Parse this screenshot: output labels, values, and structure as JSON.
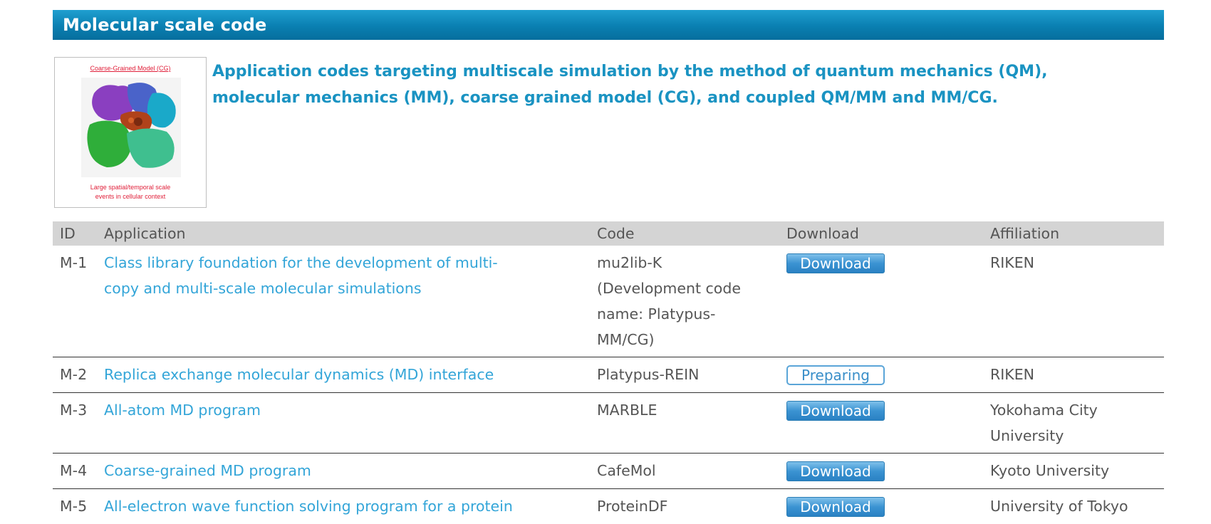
{
  "section": {
    "title": "Molecular scale code"
  },
  "thumbnail": {
    "title": "Coarse-Grained Model (CG)",
    "caption_lines": [
      "Large spatial/temporal scale",
      "events in cellular context"
    ]
  },
  "intro": {
    "lines": [
      "Application codes targeting multiscale simulation by the method of quantum mechanics (QM),",
      "molecular mechanics (MM), coarse grained model (CG), and coupled QM/MM and MM/CG."
    ]
  },
  "table": {
    "headers": {
      "id": "ID",
      "application": "Application",
      "code": "Code",
      "download": "Download",
      "affiliation": "Affiliation"
    },
    "rows": [
      {
        "id": "M-1",
        "application_lines": [
          "Class library foundation for the development of multi-",
          "copy and multi-scale molecular simulations"
        ],
        "code_lines": [
          "mu2lib-K",
          "(Development code",
          "name: Platypus-",
          "MM/CG)"
        ],
        "button": "Download",
        "affiliation_lines": [
          "RIKEN"
        ]
      },
      {
        "id": "M-2",
        "application_lines": [
          "Replica exchange molecular dynamics (MD) interface"
        ],
        "code_lines": [
          "Platypus-REIN"
        ],
        "button": "Preparing",
        "affiliation_lines": [
          "RIKEN"
        ]
      },
      {
        "id": "M-3",
        "application_lines": [
          "All-atom MD program"
        ],
        "code_lines": [
          "MARBLE"
        ],
        "button": "Download",
        "affiliation_lines": [
          "Yokohama City",
          "University"
        ]
      },
      {
        "id": "M-4",
        "application_lines": [
          "Coarse-grained MD program"
        ],
        "code_lines": [
          "CafeMol"
        ],
        "button": "Download",
        "affiliation_lines": [
          "Kyoto University"
        ]
      },
      {
        "id": "M-5",
        "application_lines": [
          "All-electron wave function solving program for a protein"
        ],
        "code_lines": [
          "ProteinDF"
        ],
        "button": "Download",
        "affiliation_lines": [
          "University of Tokyo"
        ]
      }
    ]
  },
  "colors": {
    "header_bar": "#0a7fb1",
    "intro_text": "#1a93c2",
    "link": "#33a5d8",
    "table_header_bg": "#d4d4d4",
    "thumb_red": "#e0203a"
  }
}
